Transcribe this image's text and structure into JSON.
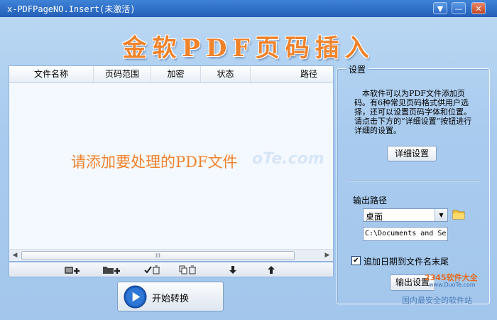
{
  "window": {
    "title": "x-PDFPageNO.Insert(未激活)"
  },
  "title_buttons": {
    "menu": "▼",
    "minimize": "—",
    "close": "✕"
  },
  "banner": "金软PDF页码插入",
  "table": {
    "columns": [
      "文件名称",
      "页码范围",
      "加密",
      "状态",
      "路径"
    ],
    "empty_hint": "请添加要处理的PDF文件",
    "watermark": "oTe.com",
    "scroll_grip": "III"
  },
  "toolbar": {
    "icons": [
      "add-file-icon",
      "add-folder-icon",
      "remove-checked-icon",
      "remove-all-icon",
      "move-down-icon",
      "move-up-icon"
    ]
  },
  "start_button": {
    "label": "开始转换"
  },
  "settings": {
    "legend": "设置",
    "description": "本软件可以为PDF文件添加页码。有6种常见页码格式供用户选择，还可以设置页码字体和位置。请点击下方的“详细设置”按钮进行详细的设置。",
    "detail_button": "详细设置",
    "output_label": "输出路径",
    "output_select": "桌面",
    "output_path": "C:\\Documents and Se",
    "append_date": {
      "label": "追加日期到文件名末尾",
      "checked": true
    },
    "output_settings_button": "输出设置"
  },
  "branding": {
    "line1": "2345软件大全",
    "line2": "www.DuoTe.com",
    "line3": "国内最安全的软件站"
  },
  "colors": {
    "accent": "#f0822a",
    "titlebar": "#2f6fcb",
    "panel": "#a9cbee"
  }
}
